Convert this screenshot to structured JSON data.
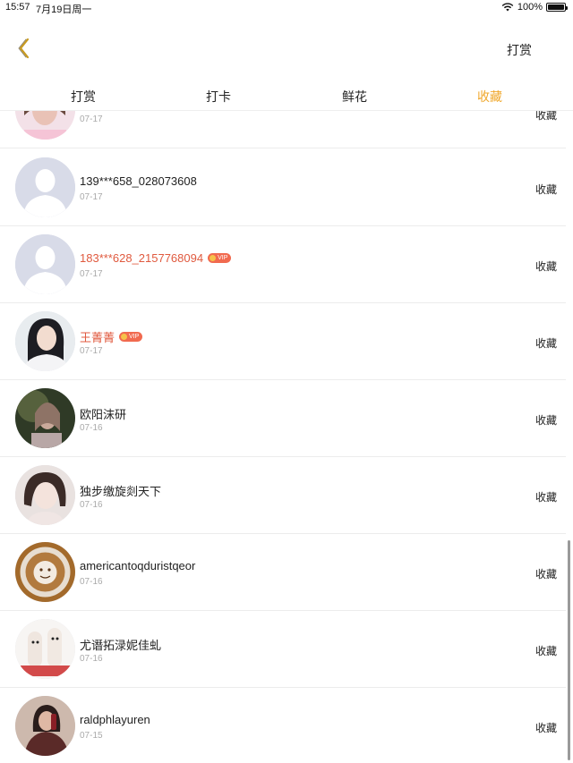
{
  "status_bar": {
    "time": "15:57",
    "date": "7月19日周一",
    "battery": "100%"
  },
  "nav": {
    "back_icon": "chevron-left-icon",
    "right_label": "打赏",
    "accent": "#f0a72a"
  },
  "tabs": [
    {
      "label": "打赏",
      "active": false
    },
    {
      "label": "打卡",
      "active": false
    },
    {
      "label": "鲜花",
      "active": false
    },
    {
      "label": "收藏",
      "active": true
    }
  ],
  "vip_label": "VIP",
  "rows": [
    {
      "name": "",
      "date": "07-17",
      "action": "收藏",
      "vip": false,
      "avatar": "photo-woman-pink"
    },
    {
      "name": "139***658_028073608",
      "date": "07-17",
      "action": "收藏",
      "vip": false,
      "avatar": "default-person"
    },
    {
      "name": "183***628_2157768094",
      "date": "07-17",
      "action": "收藏",
      "vip": true,
      "avatar": "default-person"
    },
    {
      "name": "王菁菁",
      "date": "07-17",
      "action": "收藏",
      "vip": true,
      "avatar": "photo-woman-white"
    },
    {
      "name": "欧阳沫研",
      "date": "07-16",
      "action": "收藏",
      "vip": false,
      "avatar": "photo-green"
    },
    {
      "name": "独步缴旋剡天下",
      "date": "07-16",
      "action": "收藏",
      "vip": false,
      "avatar": "photo-woman-pale"
    },
    {
      "name": "americantoqduristqeor",
      "date": "07-16",
      "action": "收藏",
      "vip": false,
      "avatar": "photo-latte"
    },
    {
      "name": "尤谮拓渌妮佳虬",
      "date": "07-16",
      "action": "收藏",
      "vip": false,
      "avatar": "photo-cartoon"
    },
    {
      "name": "raldphlayuren",
      "date": "07-15",
      "action": "收藏",
      "vip": false,
      "avatar": "photo-woman-dark"
    }
  ]
}
